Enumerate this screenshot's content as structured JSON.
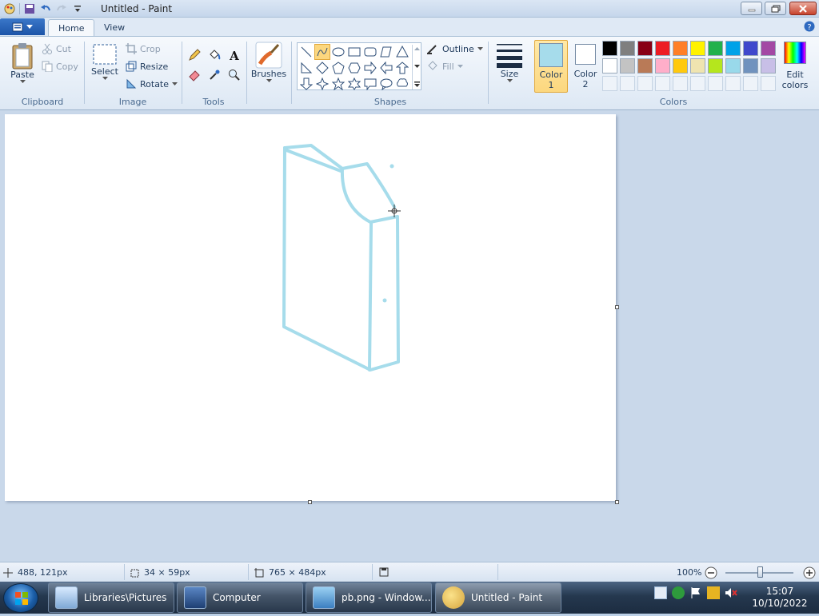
{
  "window": {
    "title": "Untitled - Paint"
  },
  "tabs": [
    {
      "label": "Home"
    },
    {
      "label": "View"
    }
  ],
  "clipboard": {
    "paste": "Paste",
    "cut": "Cut",
    "copy": "Copy",
    "group": "Clipboard"
  },
  "image": {
    "select": "Select",
    "crop": "Crop",
    "resize": "Resize",
    "rotate": "Rotate",
    "group": "Image"
  },
  "tools": {
    "group": "Tools"
  },
  "brushes": {
    "label": "Brushes"
  },
  "shapes": {
    "outline": "Outline",
    "fill": "Fill",
    "group": "Shapes"
  },
  "size": {
    "label": "Size"
  },
  "colors": {
    "color1_label": "Color 1",
    "color1_value": "#a6dceb",
    "color2_label": "Color 2",
    "color2_value": "#ffffff",
    "edit_label": "Edit colors",
    "group": "Colors",
    "palette_row1": [
      "#000000",
      "#7f7f7f",
      "#880015",
      "#ed1c24",
      "#ff7f27",
      "#fff200",
      "#22b14c",
      "#00a2e8",
      "#3f48cc",
      "#a349a4"
    ],
    "palette_row2": [
      "#ffffff",
      "#c3c3c3",
      "#b97a57",
      "#ffaec9",
      "#ffc90e",
      "#efe4b0",
      "#b5e61d",
      "#99d9ea",
      "#7092be",
      "#c8bfe7"
    ]
  },
  "status": {
    "cursor_pos": "488, 121px",
    "selection_size": "34 × 59px",
    "image_size": "765 × 484px",
    "zoom": "100%",
    "zoom_level": 0.5
  },
  "taskbar": {
    "items": [
      {
        "label": "Libraries\\Pictures"
      },
      {
        "label": "Computer"
      },
      {
        "label": "pb.png - Window..."
      },
      {
        "label": "Untitled - Paint"
      }
    ],
    "time": "15:07",
    "date": "10/10/2022"
  }
}
